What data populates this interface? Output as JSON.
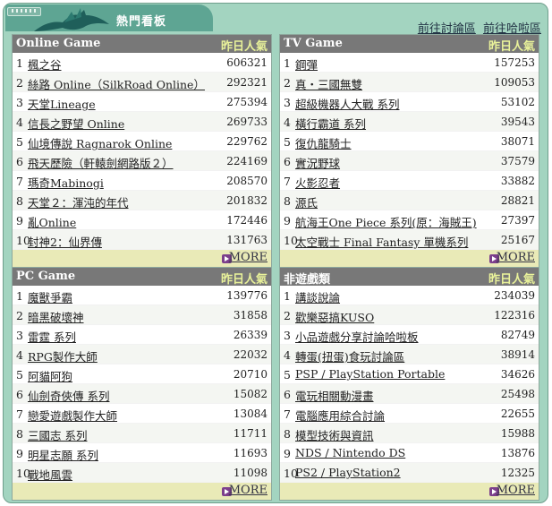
{
  "header": {
    "tab_title": "熱門看板",
    "links": [
      "前往討論區",
      "前往哈啦區"
    ]
  },
  "panels": [
    {
      "title": "Online Game",
      "col": "昨日人氣",
      "more": "MORE",
      "rows": [
        {
          "rank": "1",
          "name": "楓之谷",
          "value": "606321"
        },
        {
          "rank": "2",
          "name": "絲路 Online（SilkRoad Online）",
          "value": "292321"
        },
        {
          "rank": "3",
          "name": "天堂Lineage",
          "value": "275394"
        },
        {
          "rank": "4",
          "name": "信長之野望 Online",
          "value": "269733"
        },
        {
          "rank": "5",
          "name": "仙境傳說 Ragnarok Online",
          "value": "229762"
        },
        {
          "rank": "6",
          "name": "飛天歷險（軒轅劍網路版２）",
          "value": "224169"
        },
        {
          "rank": "7",
          "name": "瑪奇Mabinogi",
          "value": "208570"
        },
        {
          "rank": "8",
          "name": "天堂２：渾沌的年代",
          "value": "201832"
        },
        {
          "rank": "9",
          "name": "亂Online",
          "value": "172446"
        },
        {
          "rank": "10",
          "name": "封神2：仙界傳",
          "value": "131763"
        }
      ]
    },
    {
      "title": "TV Game",
      "col": "昨日人氣",
      "more": "MORE",
      "rows": [
        {
          "rank": "1",
          "name": "鋼彈",
          "value": "157253"
        },
        {
          "rank": "2",
          "name": "真‧三國無雙",
          "value": "109053"
        },
        {
          "rank": "3",
          "name": "超級機器人大戰 系列",
          "value": "53102"
        },
        {
          "rank": "4",
          "name": "橫行霸道 系列",
          "value": "39543"
        },
        {
          "rank": "5",
          "name": "復仇龍騎士",
          "value": "38071"
        },
        {
          "rank": "6",
          "name": "實況野球",
          "value": "37579"
        },
        {
          "rank": "7",
          "name": "火影忍者",
          "value": "33882"
        },
        {
          "rank": "8",
          "name": "源氏",
          "value": "28821"
        },
        {
          "rank": "9",
          "name": "航海王One Piece 系列(原：海賊王)",
          "value": "27397"
        },
        {
          "rank": "10",
          "name": "太空戰士 Final Fantasy 單機系列",
          "value": "25167"
        }
      ]
    },
    {
      "title": "PC Game",
      "col": "昨日人氣",
      "more": "MORE",
      "rows": [
        {
          "rank": "1",
          "name": "魔獸爭霸",
          "value": "139776"
        },
        {
          "rank": "2",
          "name": "暗黑破壞神",
          "value": "31858"
        },
        {
          "rank": "3",
          "name": "雷霆 系列",
          "value": "26339"
        },
        {
          "rank": "4",
          "name": "RPG製作大師",
          "value": "22032"
        },
        {
          "rank": "5",
          "name": "阿貓阿狗",
          "value": "20710"
        },
        {
          "rank": "6",
          "name": "仙劍奇俠傳 系列",
          "value": "15082"
        },
        {
          "rank": "7",
          "name": "戀愛遊戲製作大師",
          "value": "13084"
        },
        {
          "rank": "8",
          "name": "三國志 系列",
          "value": "11711"
        },
        {
          "rank": "9",
          "name": "明星志願 系列",
          "value": "11693"
        },
        {
          "rank": "10",
          "name": "戰地風雲",
          "value": "11098"
        }
      ]
    },
    {
      "title": "非遊戲類",
      "col": "昨日人氣",
      "more": "MORE",
      "rows": [
        {
          "rank": "1",
          "name": "講談說論",
          "value": "234039"
        },
        {
          "rank": "2",
          "name": "歡樂惡搞KUSO",
          "value": "122316"
        },
        {
          "rank": "3",
          "name": "小品遊戲分享討論哈啦板",
          "value": "82749"
        },
        {
          "rank": "4",
          "name": "轉蛋(扭蛋)食玩討論區",
          "value": "38914"
        },
        {
          "rank": "5",
          "name": "PSP / PlayStation Portable",
          "value": "34626"
        },
        {
          "rank": "6",
          "name": "電玩相關動漫畫",
          "value": "25498"
        },
        {
          "rank": "7",
          "name": "電腦應用綜合討論",
          "value": "22655"
        },
        {
          "rank": "8",
          "name": "模型技術與資訊",
          "value": "15988"
        },
        {
          "rank": "9",
          "name": "NDS / Nintendo DS",
          "value": "13876"
        },
        {
          "rank": "10",
          "name": "PS2 / PlayStation2",
          "value": "12325"
        }
      ]
    }
  ]
}
